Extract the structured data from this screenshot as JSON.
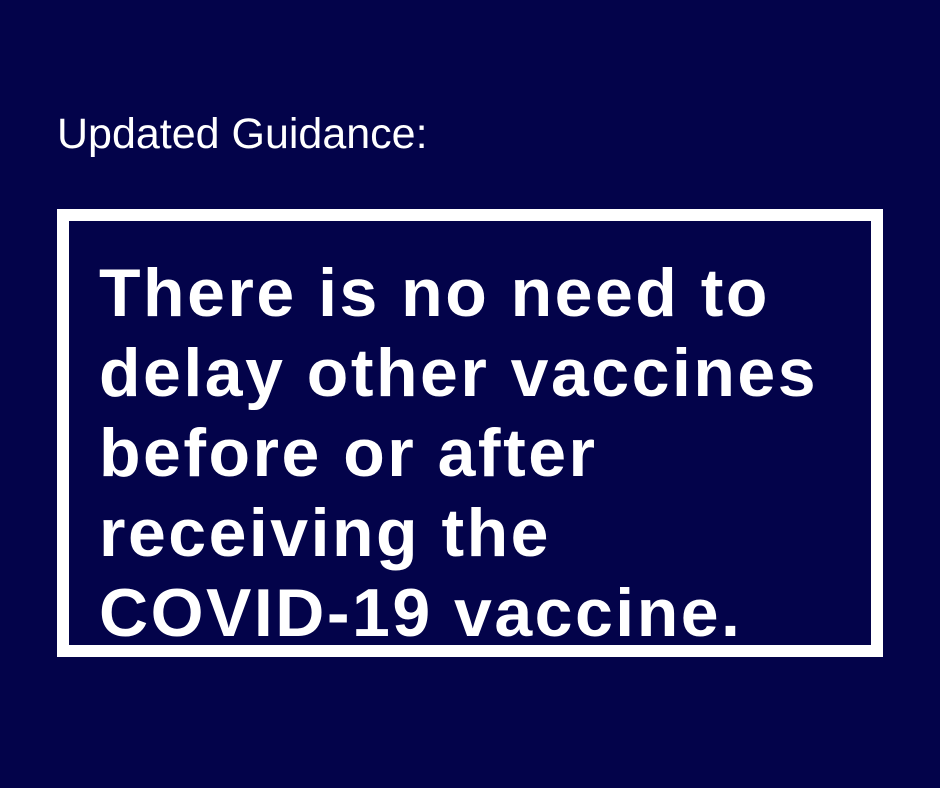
{
  "heading": "Updated Guidance:",
  "message": {
    "lines": [
      "There is no need to",
      "delay other vaccines",
      "before or after",
      "receiving the",
      "COVID-19 vaccine."
    ]
  },
  "colors": {
    "background": "#03034a",
    "text": "#ffffff",
    "border": "#ffffff"
  }
}
